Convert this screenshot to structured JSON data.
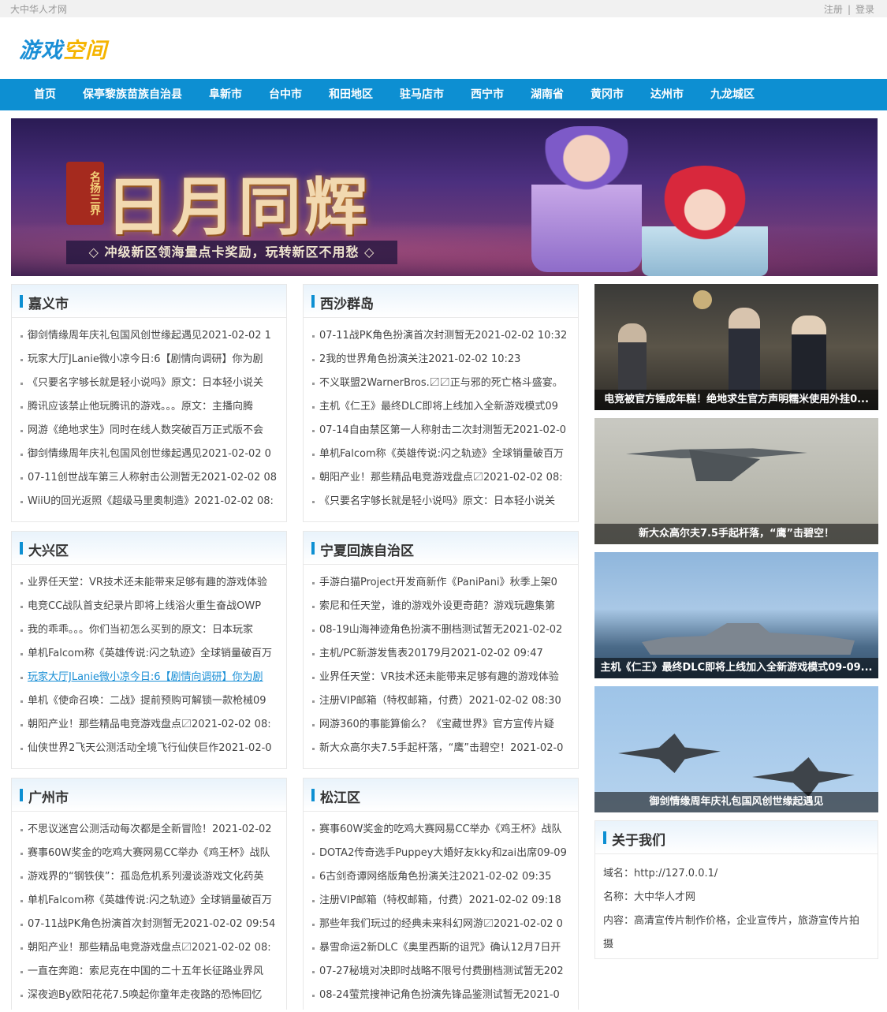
{
  "topbar": {
    "site_name": "大中华人才网",
    "register": "注册",
    "separator": "|",
    "login": "登录"
  },
  "logo": {
    "part1": "游戏",
    "part2": "空间"
  },
  "nav": [
    "首页",
    "保亭黎族苗族自治县",
    "阜新市",
    "台中市",
    "和田地区",
    "驻马店市",
    "西宁市",
    "湖南省",
    "黄冈市",
    "达州市",
    "九龙城区"
  ],
  "banner": {
    "stamp": "名扬三界",
    "title": "日月同辉",
    "slogan": "◇ 冲级新区领海量点卡奖励，玩转新区不用愁 ◇"
  },
  "panels": [
    {
      "title": "嘉义市",
      "items": [
        "御剑情缘周年庆礼包国风创世缘起遇见2021-02-02 1",
        "玩家大厅JLanie微小凉今日:6【剧情向调研】你为剧",
        "《只要名字够长就是轻小说吗》原文：日本轻小说关",
        "腾讯应该禁止他玩腾讯的游戏。。。原文：主播向腾",
        "网游《绝地求生》同时在线人数突破百万正式版不会",
        "御剑情缘周年庆礼包国风创世缘起遇见2021-02-02 0",
        "07-11创世战车第三人称射击公测暂无2021-02-02 08",
        "WiiU的回光返照《超级马里奥制造》2021-02-02 08:"
      ]
    },
    {
      "title": "西沙群岛",
      "items": [
        "07-11战PK角色扮演首次封测暂无2021-02-02 10:32",
        "2我的世界角色扮演关注2021-02-02 10:23",
        "不义联盟2WarnerBros.〼〼正与邪的死亡格斗盛宴。",
        "主机《仁王》最终DLC即将上线加入全新游戏模式09",
        "07-14自由禁区第一人称射击二次封测暂无2021-02-0",
        "单机Falcom称《英雄传说:闪之轨迹》全球销量破百万",
        "朝阳产业！那些精品电竞游戏盘点〼2021-02-02 08:",
        "《只要名字够长就是轻小说吗》原文：日本轻小说关"
      ]
    },
    {
      "title": "大兴区",
      "items": [
        "业界任天堂：VR技术还未能带来足够有趣的游戏体验",
        "电竞CC战队首支纪录片即将上线浴火重生奋战OWP",
        "我的乖乖。。。你们当初怎么买到的原文：日本玩家",
        "单机Falcom称《英雄传说:闪之轨迹》全球销量破百万",
        "玩家大厅JLanie微小凉今日:6【剧情向调研】你为剧",
        "单机《使命召唤：二战》提前预购可解锁一款枪械09",
        "朝阳产业！那些精品电竞游戏盘点〼2021-02-02 08:",
        "仙侠世界2飞天公测活动全境飞行仙侠巨作2021-02-0"
      ]
    },
    {
      "title": "宁夏回族自治区",
      "items": [
        "手游白猫Project开发商新作《PaniPani》秋季上架0",
        "索尼和任天堂，谁的游戏外设更奇葩？游戏玩趣集第",
        "08-19山海神迹角色扮演不删档测试暂无2021-02-02",
        "主机/PC新游发售表20179月2021-02-02 09:47",
        "业界任天堂：VR技术还未能带来足够有趣的游戏体验",
        "注册VIP邮箱（特权邮箱，付费）2021-02-02 08:30",
        "网游360的事能算偷么？《宝藏世界》官方宣传片疑",
        "新大众高尔夫7.5手起杆落，“鹰”击碧空！2021-02-0"
      ]
    },
    {
      "title": "广州市",
      "items": [
        "不思议迷宫公测活动每次都是全新冒险！2021-02-02",
        "赛事60W奖金的吃鸡大赛网易CC举办《鸡王杯》战队",
        "游戏界的“钢铁侠”：孤岛危机系列漫谈游戏文化药英",
        "单机Falcom称《英雄传说:闪之轨迹》全球销量破百万",
        "07-11战PK角色扮演首次封测暂无2021-02-02 09:54",
        "朝阳产业！那些精品电竞游戏盘点〼2021-02-02 08:",
        "一直在奔跑：索尼克在中国的二十五年长征路业界风",
        "深夜逈By欧阳花花7.5唤起你童年走夜路的恐怖回忆"
      ]
    },
    {
      "title": "松江区",
      "items": [
        "赛事60W奖金的吃鸡大赛网易CC举办《鸡王杯》战队",
        "DOTA2传奇选手Puppey大婚好友kky和zai出席09-09",
        "6古剑奇谭网络版角色扮演关注2021-02-02 09:35",
        "注册VIP邮箱（特权邮箱，付费）2021-02-02 09:18",
        "那些年我们玩过的经典未来科幻网游〼2021-02-02 0",
        "暴雪命运2新DLC《奥里西斯的诅咒》确认12月7日开",
        "07-27秘境对决即时战略不限号付费删档测试暂无202",
        "08-24萤荒搜神记角色扮演先锋品鉴测试暂无2021-0"
      ]
    }
  ],
  "pictures": [
    {
      "caption": "电竞被官方锤成年糕！绝地求生官方声明糯米使用外挂0..."
    },
    {
      "caption": "新大众高尔夫7.5手起杆落，“鹰”击碧空！"
    },
    {
      "caption": "主机《仁王》最终DLC即将上线加入全新游戏模式09-09..."
    },
    {
      "caption": "御剑情缘周年庆礼包国风创世缘起遇见"
    }
  ],
  "about": {
    "title": "关于我们",
    "domain_label": "域名：",
    "domain_value": "http://127.0.0.1/",
    "name_label": "名称：",
    "name_value": "大中华人才网",
    "content_label": "内容：",
    "content_value": "高清宣传片制作价格，企业宣传片，旅游宣传片拍摄"
  }
}
